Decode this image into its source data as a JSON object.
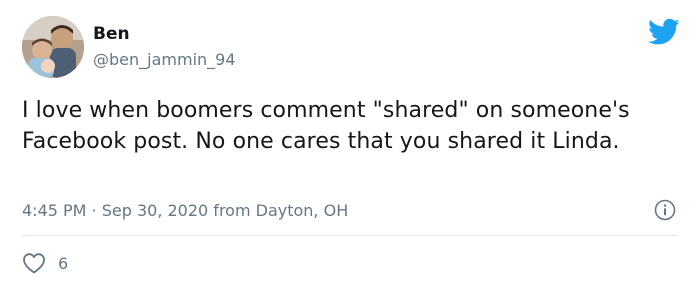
{
  "tweet": {
    "display_name": "Ben",
    "handle": "@ben_jammin_94",
    "text": "I love when boomers comment \"shared\" on someone's Facebook post. No one cares that you shared it Linda.",
    "timestamp": "4:45 PM · Sep 30, 2020 from Dayton, OH",
    "like_count": "6"
  },
  "icons": {
    "logo": "twitter-bird-icon",
    "info": "info-icon",
    "like": "heart-icon"
  },
  "colors": {
    "brand_blue": "#1da1f2",
    "secondary_text": "#657786",
    "primary_text": "#14171a",
    "divider": "#e1e8ed"
  }
}
